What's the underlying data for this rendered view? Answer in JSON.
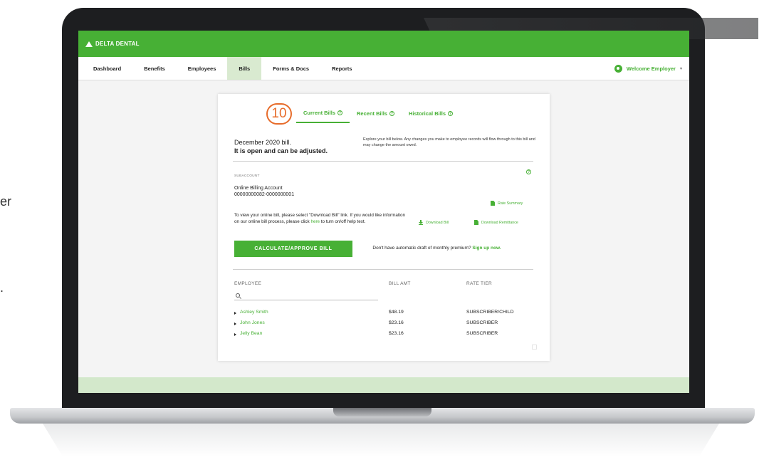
{
  "stray_text": {
    "a": "er",
    "b": "."
  },
  "brand": {
    "name": "DELTA DENTAL"
  },
  "nav": {
    "items": [
      "Dashboard",
      "Benefits",
      "Employees",
      "Bills",
      "Forms & Docs",
      "Reports"
    ],
    "active": "Bills",
    "welcome": "Welcome Employer",
    "caret": "▾"
  },
  "annotation": {
    "number": "10"
  },
  "tabs": [
    {
      "label": "Current Bills",
      "help": "?"
    },
    {
      "label": "Recent Bills",
      "help": "?"
    },
    {
      "label": "Historical Bills",
      "help": "?"
    }
  ],
  "bill": {
    "title_line1": "December 2020 bill.",
    "title_line2": "It is open and can be adjusted.",
    "explore": "Explore your bill below. Any changes you make to employee records will flow through to this bill and may change the amount owed.",
    "help": "?"
  },
  "account": {
    "label": "SUBACCOUNT",
    "name": "Online Billing Account",
    "number": "00000000082-0000000001"
  },
  "links": {
    "rate_summary": "Rate Summary",
    "download_bill": "Download Bill",
    "download_remittance": "Download Remittance"
  },
  "info": {
    "text_before": "To view your online bill, please select \"Download Bill\" link. If you would like information on our online bill process, please click ",
    "link": "here",
    "text_after": " to turn on/off help text."
  },
  "actions": {
    "calculate": "CALCULATE/APPROVE BILL",
    "draft_text": "Don't have automatic draft of monthly premium? ",
    "draft_link": "Sign up now."
  },
  "table": {
    "headers": {
      "employee": "EMPLOYEE",
      "bill_amt": "BILL AMT",
      "rate_tier": "RATE TIER"
    },
    "search_placeholder": "",
    "rows": [
      {
        "name": "Ashley Smith",
        "amount": "$48.19",
        "tier": "SUBSCRIBER/CHILD"
      },
      {
        "name": "John Jones",
        "amount": "$23.16",
        "tier": "SUBSCRIBER"
      },
      {
        "name": "Jelly Bean",
        "amount": "$23.16",
        "tier": "SUBSCRIBER"
      }
    ]
  },
  "colors": {
    "brand_green": "#47b035",
    "active_tab_bg": "#d9ead0",
    "annotation_orange": "#e76c2b",
    "footer_band": "#d3e8cb"
  }
}
